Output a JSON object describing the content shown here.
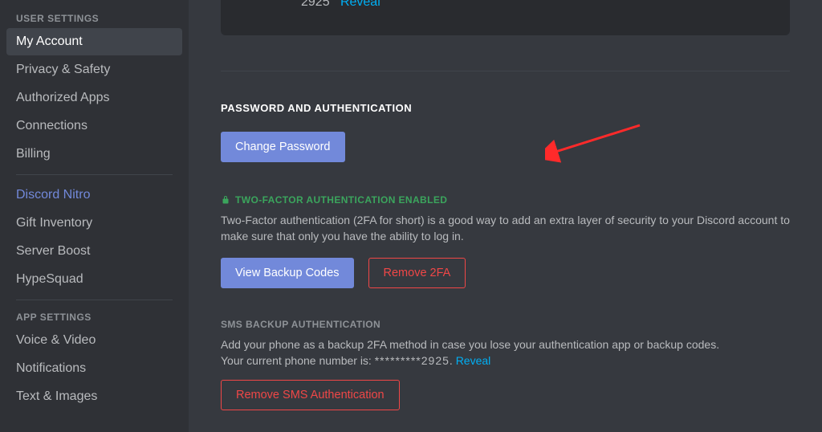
{
  "sidebar": {
    "user_settings_header": "User Settings",
    "items_user": [
      {
        "label": "My Account",
        "active": true
      },
      {
        "label": "Privacy & Safety"
      },
      {
        "label": "Authorized Apps"
      },
      {
        "label": "Connections"
      },
      {
        "label": "Billing"
      }
    ],
    "items_nitro": [
      {
        "label": "Discord Nitro",
        "nitro": true
      },
      {
        "label": "Gift Inventory"
      },
      {
        "label": "Server Boost"
      },
      {
        "label": "HypeSquad"
      }
    ],
    "app_settings_header": "App Settings",
    "items_app": [
      {
        "label": "Voice & Video"
      },
      {
        "label": "Notifications"
      },
      {
        "label": "Text & Images"
      }
    ]
  },
  "top_fragment": {
    "partial_number": "2925",
    "reveal": "Reveal"
  },
  "password_section": {
    "title": "Password and Authentication",
    "change_password": "Change Password"
  },
  "twofa_section": {
    "header": "Two-Factor Authentication Enabled",
    "desc": "Two-Factor authentication (2FA for short) is a good way to add an extra layer of security to your Discord account to make sure that only you have the ability to log in.",
    "view_backup": "View Backup Codes",
    "remove_2fa": "Remove 2FA"
  },
  "sms_section": {
    "header": "SMS Backup Authentication",
    "desc_line1": "Add your phone as a backup 2FA method in case you lose your authentication app or backup codes.",
    "desc_line2_prefix": "Your current phone number is: ",
    "masked": "*********2925",
    "reveal": "Reveal",
    "remove_sms": "Remove SMS Authentication"
  }
}
